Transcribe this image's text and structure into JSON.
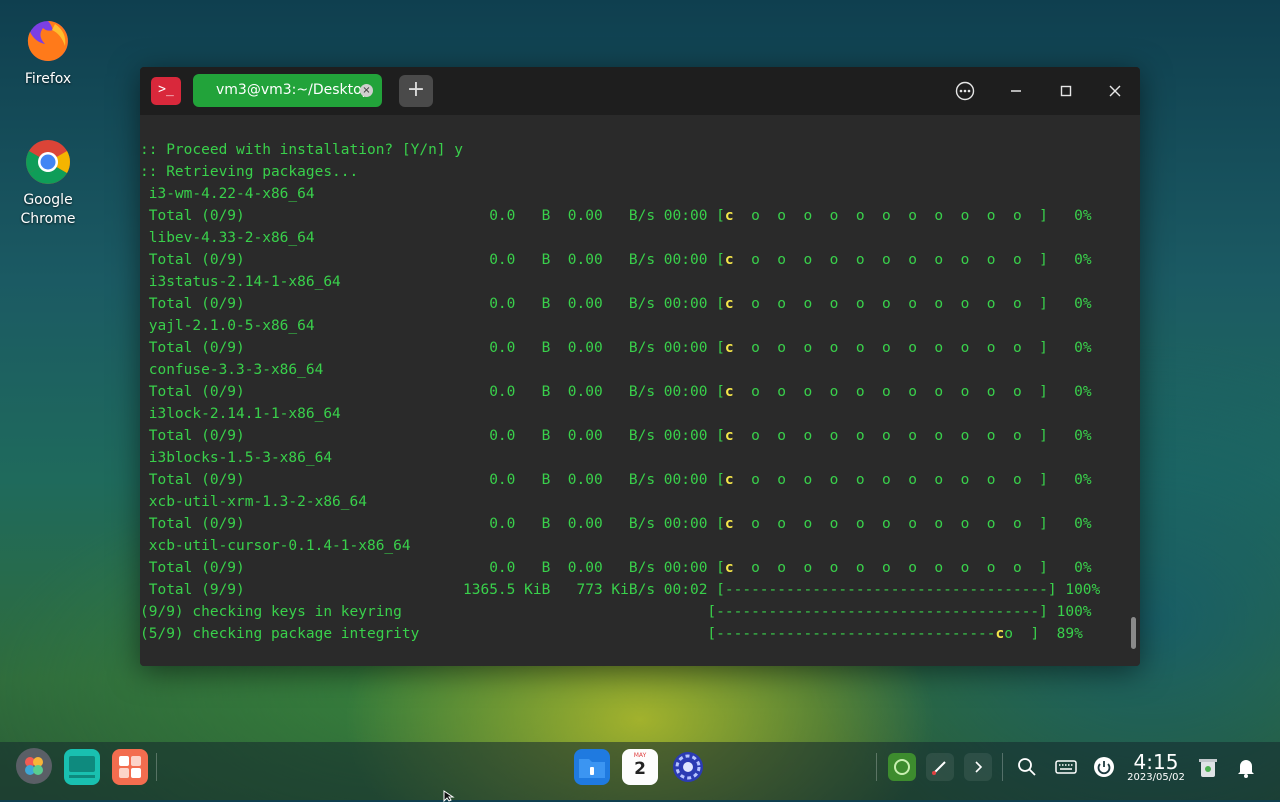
{
  "desktop": {
    "icons": [
      {
        "label": "Firefox"
      },
      {
        "label": "Google\nChrome"
      }
    ]
  },
  "window": {
    "tab_label": "vm3@vm3:~/Desktop",
    "tab_close": "×",
    "new_tab": "+",
    "app_icon_glyph": ">_"
  },
  "terminal": {
    "lines": [
      ":: Proceed with installation? [Y/n] y",
      ":: Retrieving packages...",
      " i3-wm-4.22-4-x86_64",
      " Total (0/9)                            0.0   B  0.00   B/s 00:00 [",
      " libev-4.33-2-x86_64",
      " Total (0/9)                            0.0   B  0.00   B/s 00:00 [",
      " i3status-2.14-1-x86_64",
      " Total (0/9)                            0.0   B  0.00   B/s 00:00 [",
      " yajl-2.1.0-5-x86_64",
      " Total (0/9)                            0.0   B  0.00   B/s 00:00 [",
      " confuse-3.3-3-x86_64",
      " Total (0/9)                            0.0   B  0.00   B/s 00:00 [",
      " i3lock-2.14.1-1-x86_64",
      " Total (0/9)                            0.0   B  0.00   B/s 00:00 [",
      " i3blocks-1.5-3-x86_64",
      " Total (0/9)                            0.0   B  0.00   B/s 00:00 [",
      " xcb-util-xrm-1.3-2-x86_64",
      " Total (0/9)                            0.0   B  0.00   B/s 00:00 [",
      " xcb-util-cursor-0.1.4-1-x86_64",
      " Total (0/9)                            0.0   B  0.00   B/s 00:00 [",
      " Total (9/9)                         1365.5 KiB   773 KiB/s 00:02 [-------------------------------------] 100%",
      "(9/9) checking keys in keyring                                   [-------------------------------------] 100%",
      "(5/9) checking package integrity                                 [--------------------------------"
    ],
    "pacman_c": "c",
    "pacman_tail": "  o  o  o  o  o  o  o  o  o  o  o  ]   0%",
    "integrity_tail": "o  ]  89%"
  },
  "taskbar": {
    "calendar_month": "MAY",
    "calendar_day": "2",
    "time": "4:15",
    "date": "2023/05/02"
  }
}
